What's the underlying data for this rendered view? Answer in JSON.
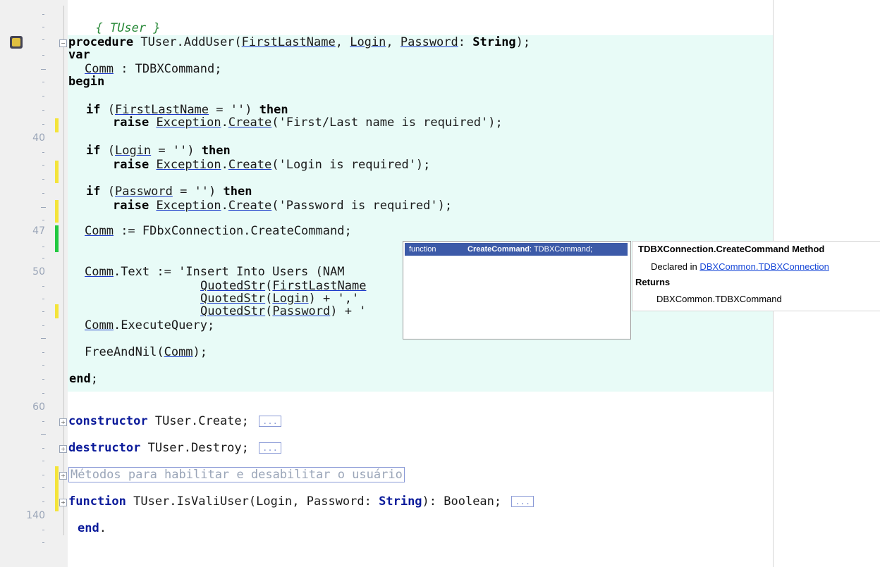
{
  "editor": {
    "line_numbers": {
      "n40": "40",
      "n47": "47",
      "n50": "50",
      "n60": "60",
      "n140": "140"
    },
    "code": {
      "l_comment": "{ TUser }",
      "proc_kw": "procedure",
      "proc_name": " TUser.AddUser(",
      "p1": "FirstLastName",
      "sep1": ", ",
      "p2": "Login",
      "sep2": ", ",
      "p3": "Password",
      "proc_tail_a": ": ",
      "string_kw": "String",
      "proc_tail_b": ");",
      "var_kw": "var",
      "comm_decl_a": "Comm",
      "comm_decl_b": " : TDBXCommand;",
      "begin_kw": "begin",
      "if_kw": "if",
      "then_kw": "then",
      "raise_kw": "raise",
      "if1_a": " (",
      "if1_b": " = '') ",
      "raise1_a": " ",
      "exception": "Exception",
      "create": "Create",
      "raise1_b": "('First/Last name is required');",
      "if2_a": " (",
      "if2_b": " = '') ",
      "raise2_b": "('Login is required');",
      "if3_a": " (",
      "if3_b": " = '') ",
      "raise3_b": "('Password is required');",
      "dot": ".",
      "comm": "Comm",
      "assign_a": " := FDbxConnection.CreateCommand;",
      "text_a": ".Text := 'Insert Into Users (NAM",
      "quoted": "QuotedStr",
      "q1_a": "(",
      "q1_b": "",
      "q2_a": "(",
      "q2_b": ") + ','",
      "q3_a": "(",
      "q3_b": ") + '",
      "exec_a": ".ExecuteQuery;",
      "free_a": "FreeAndNil(",
      "free_b": ");",
      "end_kw": "end",
      "semi": ";",
      "ctor_kw": "constructor",
      "ctor_rest": " TUser.Create; ",
      "dtor_kw": "destructor",
      "dtor_rest": " TUser.Destroy; ",
      "fold_dots": "...",
      "region_text": "Métodos para habilitar e desabilitar o usuário",
      "func_kw": "function",
      "func_rest_a": " TUser.IsValiUser(Login, Password: ",
      "func_string": "String",
      "func_rest_b": "): Boolean; ",
      "end_final": "end",
      "period": "."
    }
  },
  "completion": {
    "kind": "function",
    "name": "CreateCommand",
    "signature": ": TDBXCommand;"
  },
  "help": {
    "title": "TDBXConnection.CreateCommand Method",
    "declared_label": "Declared in ",
    "declared_link": "DBXCommon.TDBXConnection",
    "returns_label": "Returns",
    "returns_type": "DBXCommon.TDBXCommand"
  },
  "colors": {
    "highlight_bg": "#e8fbf7",
    "keyword_blue": "#0a1a9a",
    "comment_green": "#2a8a3a",
    "selection": "#3c5aa8"
  }
}
